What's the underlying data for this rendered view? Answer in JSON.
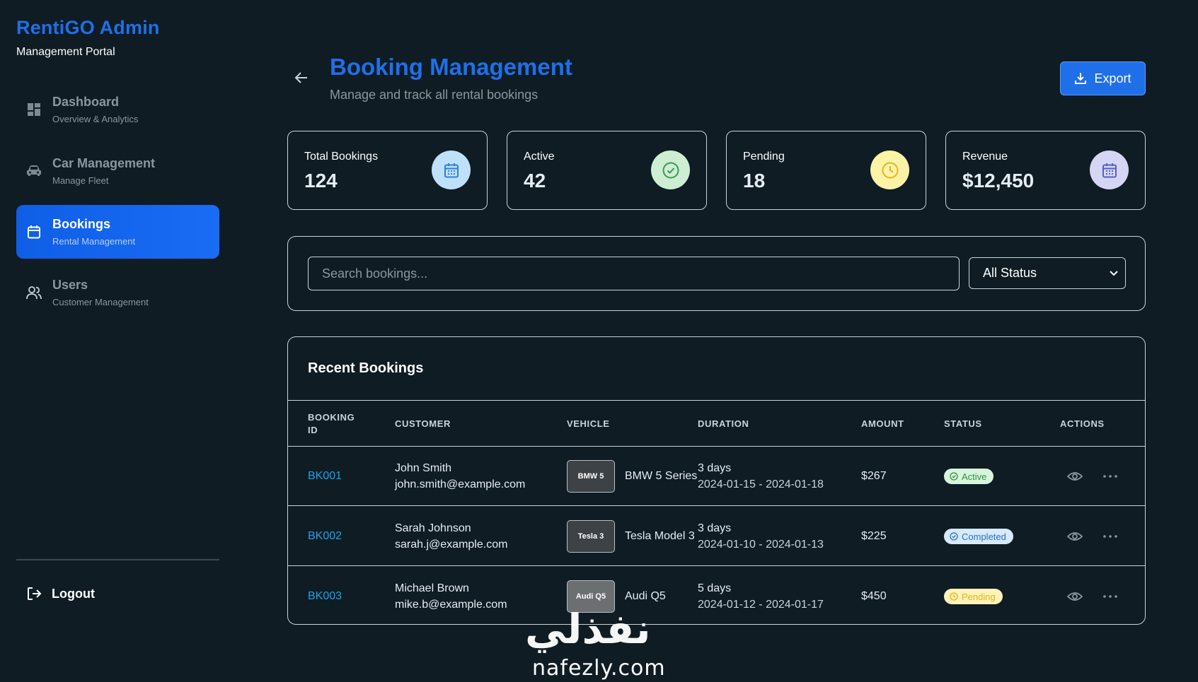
{
  "brand": {
    "title": "RentiGO Admin",
    "subtitle": "Management Portal"
  },
  "sidebar": {
    "items": [
      {
        "label": "Dashboard",
        "sub": "Overview & Analytics",
        "icon": "dashboard-icon"
      },
      {
        "label": "Car Management",
        "sub": "Manage Fleet",
        "icon": "car-icon"
      },
      {
        "label": "Bookings",
        "sub": "Rental Management",
        "icon": "calendar-icon",
        "active": true
      },
      {
        "label": "Users",
        "sub": "Customer Management",
        "icon": "users-icon"
      }
    ],
    "logout": "Logout"
  },
  "header": {
    "title": "Booking Management",
    "subtitle": "Manage and track all rental bookings",
    "export_label": "Export"
  },
  "stats": [
    {
      "label": "Total Bookings",
      "value": "124",
      "icon": "calendar-icon",
      "color": "#bfe0fb"
    },
    {
      "label": "Active",
      "value": "42",
      "icon": "check-circle-icon",
      "color": "#cdeed3"
    },
    {
      "label": "Pending",
      "value": "18",
      "icon": "clock-icon",
      "color": "#fbf3a6"
    },
    {
      "label": "Revenue",
      "value": "$12,450",
      "icon": "calendar-icon",
      "color": "#d4d6f3"
    }
  ],
  "filters": {
    "search_placeholder": "Search bookings...",
    "status_value": "All Status"
  },
  "table": {
    "title": "Recent Bookings",
    "columns": [
      "BOOKING ID",
      "CUSTOMER",
      "VEHICLE",
      "DURATION",
      "AMOUNT",
      "STATUS",
      "ACTIONS"
    ],
    "rows": [
      {
        "id": "BK001",
        "name": "John Smith",
        "email": "john.smith@example.com",
        "thumb": "BMW 5",
        "vehicle": "BMW 5 Series",
        "days": "3 days",
        "range": "2024-01-15 - 2024-01-18",
        "amount": "$267",
        "status": "Active"
      },
      {
        "id": "BK002",
        "name": "Sarah Johnson",
        "email": "sarah.j@example.com",
        "thumb": "Tesla 3",
        "vehicle": "Tesla Model 3",
        "days": "3 days",
        "range": "2024-01-10 - 2024-01-13",
        "amount": "$225",
        "status": "Completed"
      },
      {
        "id": "BK003",
        "name": "Michael Brown",
        "email": "mike.b@example.com",
        "thumb": "Audi Q5",
        "vehicle": "Audi Q5",
        "days": "5 days",
        "range": "2024-01-12 - 2024-01-17",
        "amount": "$450",
        "status": "Pending"
      }
    ]
  },
  "watermark": {
    "arabic": "نفذلي",
    "latin": "nafezly.com"
  }
}
